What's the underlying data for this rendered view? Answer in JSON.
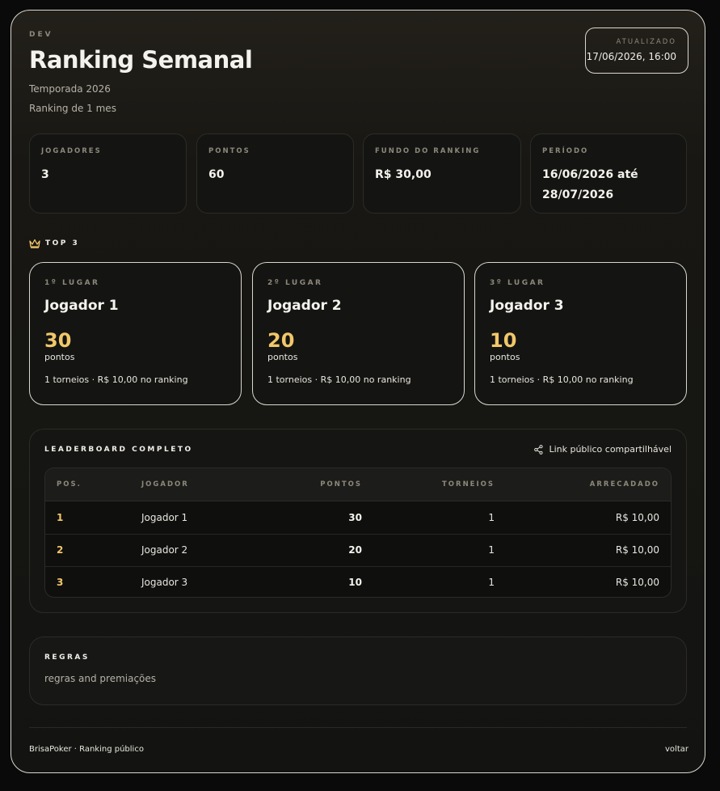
{
  "header": {
    "eyebrow": "DEV",
    "title": "Ranking Semanal",
    "subtitle": "Temporada 2026",
    "subtitle2": "Ranking de 1 mes",
    "updated_label": "ATUALIZADO",
    "updated_value": "17/06/2026, 16:00"
  },
  "stats": [
    {
      "label": "JOGADORES",
      "value": "3"
    },
    {
      "label": "PONTOS",
      "value": "60"
    },
    {
      "label": "FUNDO DO RANKING",
      "value": "R$ 30,00"
    },
    {
      "label": "PERÍODO",
      "value_line1": "16/06/2026 até",
      "value_line2": "28/07/2026"
    }
  ],
  "top3": {
    "label": "TOP 3",
    "icon": "crown-icon",
    "accent": "#f1c76a",
    "cards": [
      {
        "place": "1º LUGAR",
        "name": "Jogador 1",
        "points": "30",
        "points_label": "pontos",
        "meta": "1 torneios · R$ 10,00 no ranking"
      },
      {
        "place": "2º LUGAR",
        "name": "Jogador 2",
        "points": "20",
        "points_label": "pontos",
        "meta": "1 torneios · R$ 10,00 no ranking"
      },
      {
        "place": "3º LUGAR",
        "name": "Jogador 3",
        "points": "10",
        "points_label": "pontos",
        "meta": "1 torneios · R$ 10,00 no ranking"
      }
    ]
  },
  "leaderboard": {
    "title": "LEADERBOARD COMPLETO",
    "share_label": "Link público compartilhável",
    "share_icon": "share-icon",
    "columns": [
      "POS.",
      "JOGADOR",
      "PONTOS",
      "TORNEIOS",
      "ARRECADADO"
    ],
    "rows": [
      {
        "pos": "1",
        "player": "Jogador 1",
        "points": "30",
        "tournaments": "1",
        "collected": "R$ 10,00"
      },
      {
        "pos": "2",
        "player": "Jogador 2",
        "points": "20",
        "tournaments": "1",
        "collected": "R$ 10,00"
      },
      {
        "pos": "3",
        "player": "Jogador 3",
        "points": "10",
        "tournaments": "1",
        "collected": "R$ 10,00"
      }
    ]
  },
  "rules": {
    "label": "REGRAS",
    "text": "regras and premiações"
  },
  "footer": {
    "left": "BrisaPoker · Ranking público",
    "right": "voltar"
  }
}
